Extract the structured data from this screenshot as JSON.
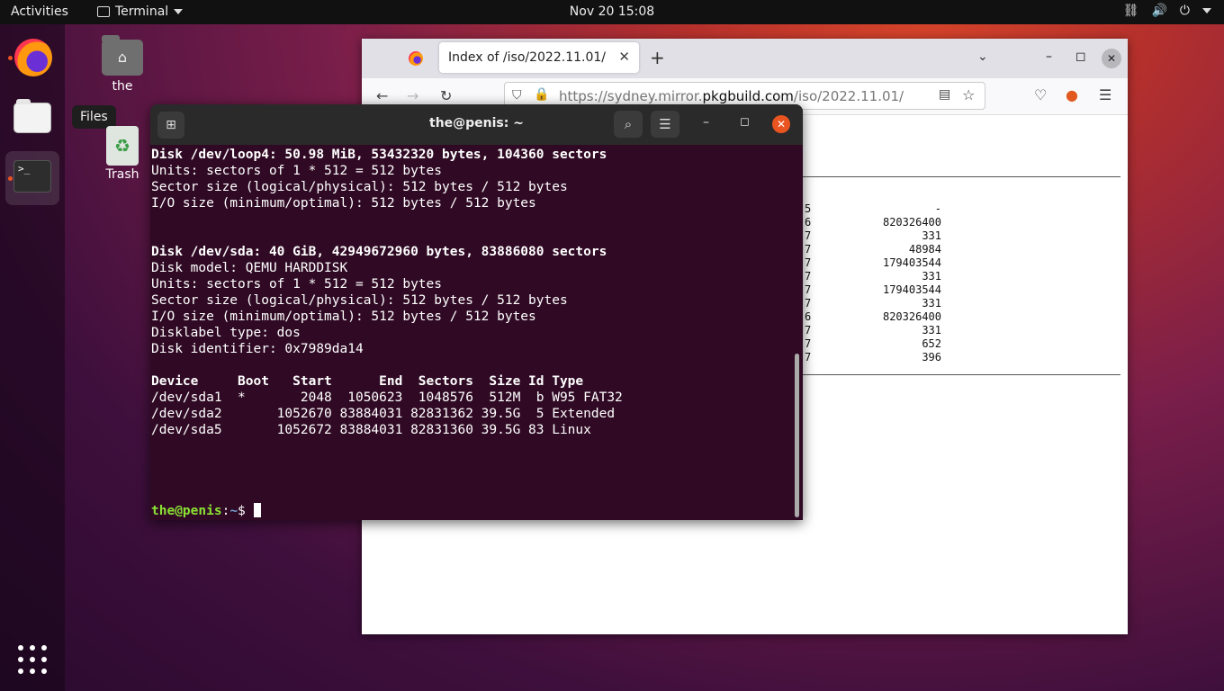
{
  "topbar": {
    "activities": "Activities",
    "app_name": "Terminal",
    "clock": "Nov 20  15:08",
    "tray_network": "⛓",
    "tray_volume": "🔊",
    "tray_power": "⏻"
  },
  "dock": {
    "tooltip": "Files"
  },
  "desktop": {
    "home_label": "the",
    "trash_label": "Trash"
  },
  "firefox": {
    "tab_title": "Index of /iso/2022.11.01/",
    "url_pre": "https://sydney.mirror.",
    "url_domain": "pkgbuild.com",
    "url_post": "/iso/2022.11.01/",
    "listing": [
      {
        "a": "5",
        "b": "-"
      },
      {
        "a": "6",
        "b": "820326400"
      },
      {
        "a": "7",
        "b": "331"
      },
      {
        "a": "7",
        "b": "48984"
      },
      {
        "a": "7",
        "b": "179403544"
      },
      {
        "a": "7",
        "b": "331"
      },
      {
        "a": "7",
        "b": "179403544"
      },
      {
        "a": "7",
        "b": "331"
      },
      {
        "a": "6",
        "b": "820326400"
      },
      {
        "a": "7",
        "b": "331"
      },
      {
        "a": "7",
        "b": "652"
      },
      {
        "a": "7",
        "b": "396"
      }
    ]
  },
  "terminal": {
    "title": "the@penis: ~",
    "lines": [
      {
        "text": "Disk /dev/loop4: 50.98 MiB, 53432320 bytes, 104360 sectors",
        "bold": true
      },
      {
        "text": "Units: sectors of 1 * 512 = 512 bytes",
        "bold": false
      },
      {
        "text": "Sector size (logical/physical): 512 bytes / 512 bytes",
        "bold": false
      },
      {
        "text": "I/O size (minimum/optimal): 512 bytes / 512 bytes",
        "bold": false
      },
      {
        "text": "",
        "bold": false
      },
      {
        "text": "",
        "bold": false
      },
      {
        "text": "Disk /dev/sda: 40 GiB, 42949672960 bytes, 83886080 sectors",
        "bold": true
      },
      {
        "text": "Disk model: QEMU HARDDISK",
        "bold": false
      },
      {
        "text": "Units: sectors of 1 * 512 = 512 bytes",
        "bold": false
      },
      {
        "text": "Sector size (logical/physical): 512 bytes / 512 bytes",
        "bold": false
      },
      {
        "text": "I/O size (minimum/optimal): 512 bytes / 512 bytes",
        "bold": false
      },
      {
        "text": "Disklabel type: dos",
        "bold": false
      },
      {
        "text": "Disk identifier: 0x7989da14",
        "bold": false
      },
      {
        "text": "",
        "bold": false
      },
      {
        "text": "Device     Boot   Start      End  Sectors  Size Id Type",
        "bold": true
      },
      {
        "text": "/dev/sda1  *       2048  1050623  1048576  512M  b W95 FAT32",
        "bold": false
      },
      {
        "text": "/dev/sda2       1052670 83884031 82831362 39.5G  5 Extended",
        "bold": false
      },
      {
        "text": "/dev/sda5       1052672 83884031 82831360 39.5G 83 Linux",
        "bold": false
      },
      {
        "text": "",
        "bold": false
      },
      {
        "text": "",
        "bold": false
      },
      {
        "text": "",
        "bold": false
      },
      {
        "text": "",
        "bold": false
      }
    ],
    "prompt_user": "the@penis",
    "prompt_sep": ":",
    "prompt_path": "~",
    "prompt_symbol": "$ "
  }
}
